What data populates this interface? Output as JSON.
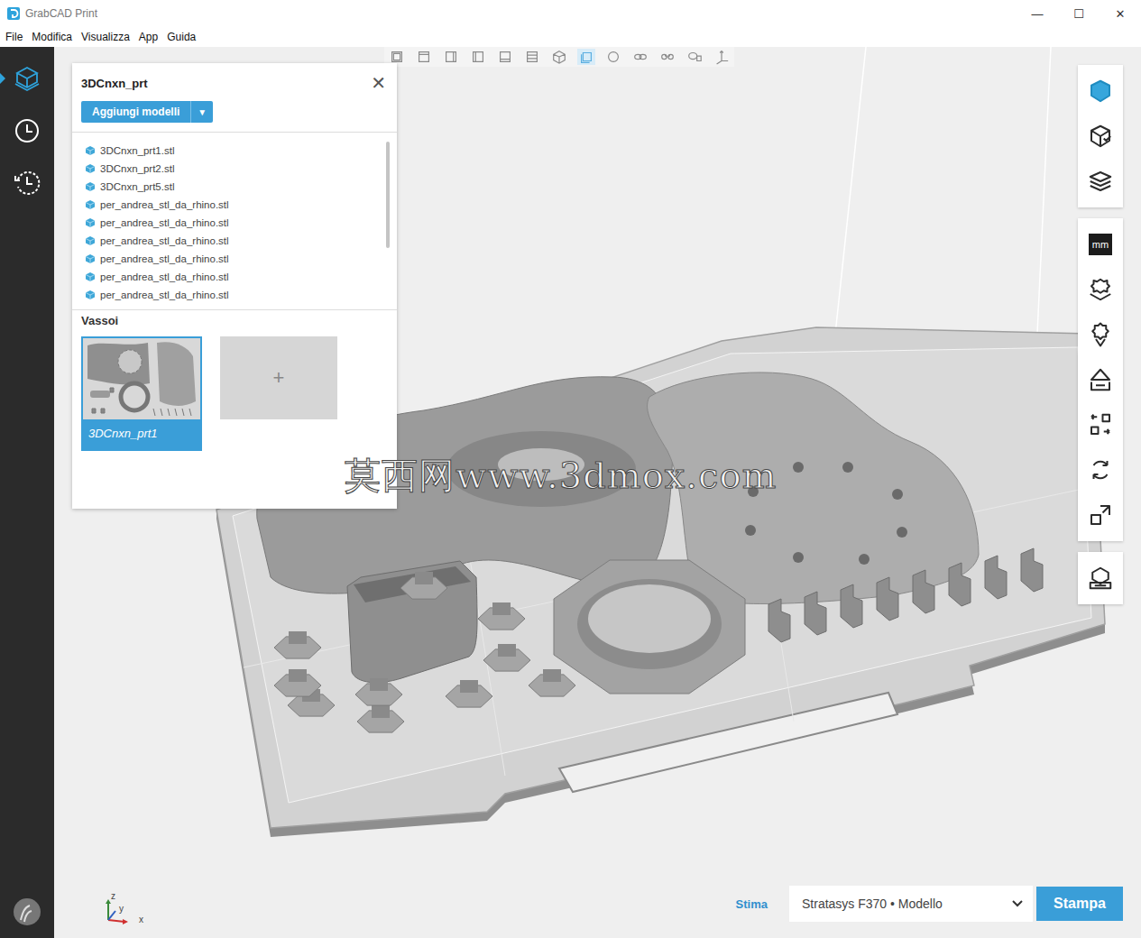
{
  "window": {
    "title": "GrabCAD Print",
    "controls": [
      "—",
      "☐",
      "✕"
    ]
  },
  "menu": [
    "File",
    "Modifica",
    "Visualizza",
    "App",
    "Guida"
  ],
  "sidebar": {
    "items": [
      {
        "selected": true
      },
      {
        "selected": false
      },
      {
        "selected": false
      }
    ]
  },
  "toolbar": {
    "tools": [
      {
        "selected": false
      },
      {
        "selected": false
      },
      {
        "selected": false
      },
      {
        "selected": false
      },
      {
        "selected": false
      },
      {
        "selected": false
      },
      {
        "selected": false
      },
      {
        "selected": true
      },
      {
        "selected": false
      },
      {
        "selected": false
      },
      {
        "selected": false
      },
      {
        "selected": false
      },
      {
        "selected": false
      }
    ]
  },
  "panel": {
    "title": "3DCnxn_prt",
    "close": "✕",
    "add_button": {
      "label": "Aggiungi modelli",
      "arrow": "▼"
    },
    "files": [
      "3DCnxn_prt1.stl",
      "3DCnxn_prt2.stl",
      "3DCnxn_prt5.stl",
      "per_andrea_stl_da_rhino.stl",
      "per_andrea_stl_da_rhino.stl",
      "per_andrea_stl_da_rhino.stl",
      "per_andrea_stl_da_rhino.stl",
      "per_andrea_stl_da_rhino.stl",
      "per_andrea_stl_da_rhino.stl"
    ],
    "trays_title": "Vassoi",
    "trays": [
      {
        "label": "3DCnxn_prt1",
        "selected": true
      }
    ],
    "add_tray": "+"
  },
  "right_toolbar": {
    "groups": [
      {
        "items": [
          {
            "selected": true
          },
          {
            "selected": false
          },
          {
            "selected": false
          }
        ]
      },
      {
        "items": [
          {
            "label": "mm",
            "selected": false
          },
          {
            "selected": false
          },
          {
            "selected": false
          },
          {
            "selected": false
          },
          {
            "selected": false
          },
          {
            "selected": false
          },
          {
            "selected": false
          }
        ]
      },
      {
        "items": [
          {
            "selected": false
          }
        ]
      }
    ]
  },
  "axis": {
    "x": "x",
    "y": "y",
    "z": "z"
  },
  "bottom": {
    "estimate": "Stima",
    "printer": "Stratasys F370 • Modello",
    "print_button": "Stampa"
  },
  "watermark": "莫西网www.3dmox.com"
}
